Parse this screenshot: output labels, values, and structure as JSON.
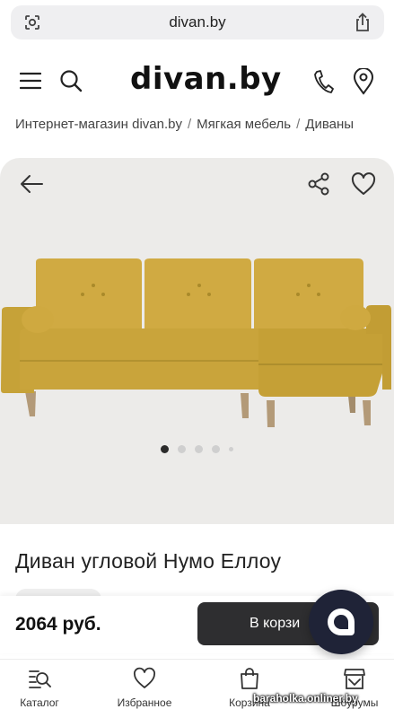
{
  "browser": {
    "url": "divan.by",
    "left_icon": "page-settings-icon",
    "right_icon": "share-icon"
  },
  "header": {
    "logo": "divan.by",
    "icons": [
      "menu-icon",
      "search-icon",
      "phone-icon",
      "location-pin-icon"
    ]
  },
  "breadcrumb": {
    "items": [
      "Интернет-магазин divan.by",
      "Мягкая мебель",
      "Диваны"
    ],
    "separator": "/"
  },
  "gallery": {
    "icons": [
      "back-arrow-icon",
      "share-icon",
      "heart-icon"
    ],
    "image": "yellow-corner-sofa",
    "slide_count": 5,
    "active_slide": 1,
    "colors": {
      "sofa": "#c9a43b",
      "background": "#ecebe9"
    }
  },
  "product": {
    "title": "Диван угловой Нумо Еллоу"
  },
  "pricebar": {
    "price": "2064 руб.",
    "cart_button": "В корзи"
  },
  "chat": {
    "icon": "chat-bubble-icon",
    "color": "#1f2337"
  },
  "bottom_nav": {
    "items": [
      {
        "label": "Каталог",
        "icon": "catalog-search-icon"
      },
      {
        "label": "Избранное",
        "icon": "heart-icon"
      },
      {
        "label": "Корзина",
        "icon": "shopping-bag-icon"
      },
      {
        "label": "Шоурумы",
        "icon": "store-icon"
      }
    ]
  },
  "watermark": "baraholka.onliner.by"
}
